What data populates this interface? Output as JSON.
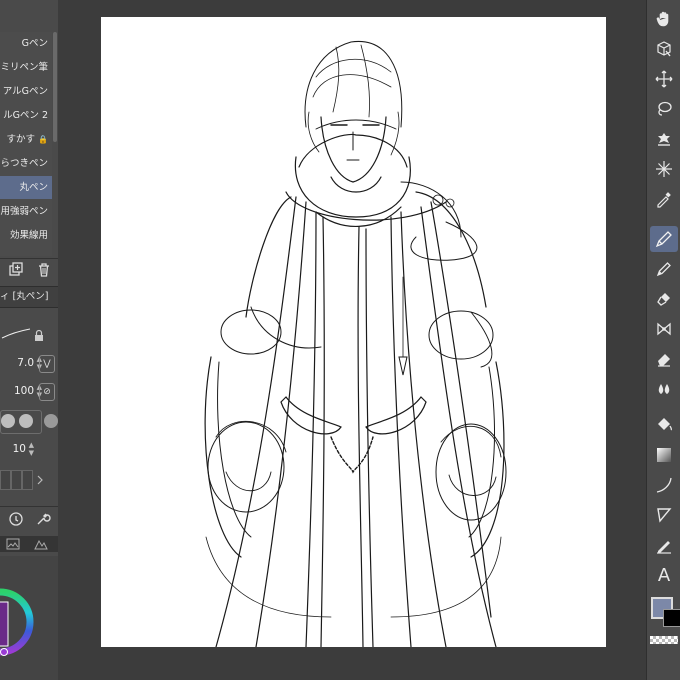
{
  "brush_list": {
    "items": [
      {
        "label": "Gペン",
        "selected": false,
        "locked": false
      },
      {
        "label": "ミリペン筆",
        "selected": false,
        "locked": false
      },
      {
        "label": "アルGペン",
        "selected": false,
        "locked": false
      },
      {
        "label": "ルGペン 2",
        "selected": false,
        "locked": false
      },
      {
        "label": "すかす",
        "selected": false,
        "locked": true
      },
      {
        "label": "らつきペン",
        "selected": false,
        "locked": false
      },
      {
        "label": "丸ペン",
        "selected": true,
        "locked": false
      },
      {
        "label": "用強弱ペン",
        "selected": false,
        "locked": false
      },
      {
        "label": "効果線用",
        "selected": false,
        "locked": false
      }
    ]
  },
  "tool_property": {
    "title": "ィ [丸ペン]",
    "brush_size": "7.0",
    "opacity": "100",
    "stabilization": "10"
  },
  "right_tools": [
    {
      "name": "hand-icon",
      "active": false
    },
    {
      "name": "object-icon",
      "active": false
    },
    {
      "name": "move-icon",
      "active": false
    },
    {
      "name": "lasso-icon",
      "active": false
    },
    {
      "name": "auto-select-icon",
      "active": false
    },
    {
      "name": "sparkle-icon",
      "active": false
    },
    {
      "name": "eyedropper-icon",
      "active": false
    },
    {
      "name": "pen-icon",
      "active": true
    },
    {
      "name": "pencil-icon",
      "active": false
    },
    {
      "name": "brush-icon",
      "active": false
    },
    {
      "name": "decoration-icon",
      "active": false
    },
    {
      "name": "eraser-icon",
      "active": false
    },
    {
      "name": "blend-icon",
      "active": false
    },
    {
      "name": "fill-icon",
      "active": false
    },
    {
      "name": "gradient-icon",
      "active": false
    },
    {
      "name": "curve-icon",
      "active": false
    },
    {
      "name": "figure-icon",
      "active": false
    },
    {
      "name": "ruler-pen-icon",
      "active": false
    },
    {
      "name": "text-icon",
      "active": false
    }
  ],
  "text_tool_glyph": "A",
  "colors": {
    "main": "#7c88a8",
    "sub": "#000000",
    "accent": "#5d6c8c"
  }
}
